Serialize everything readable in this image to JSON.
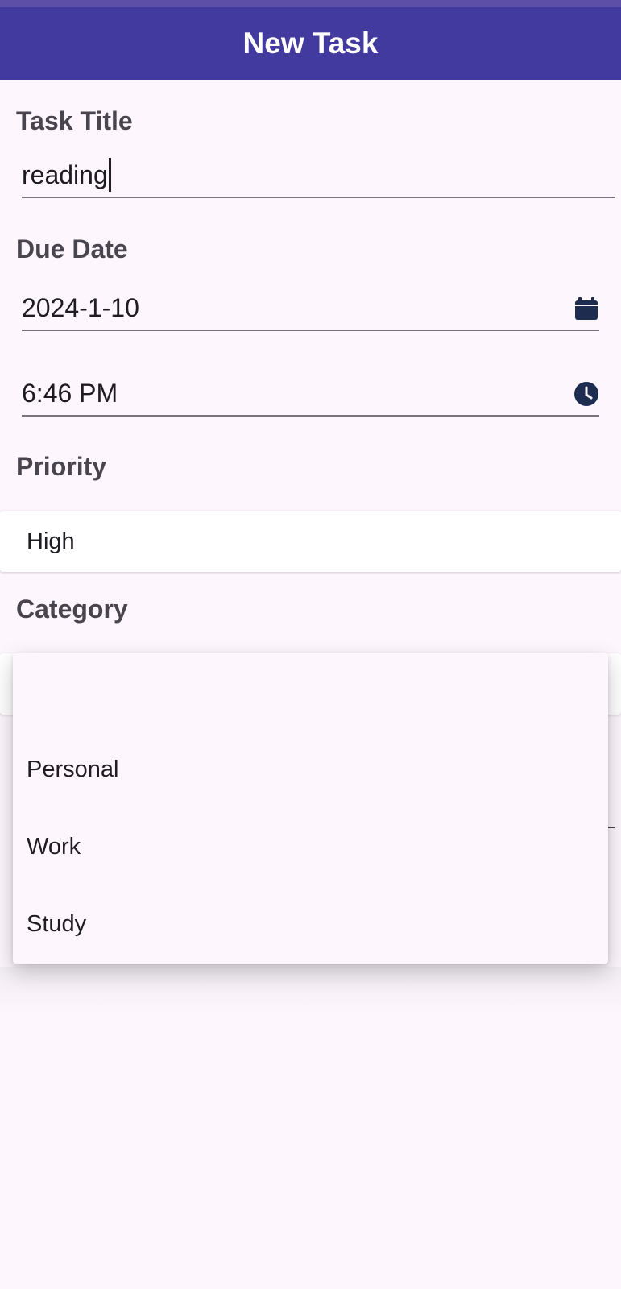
{
  "app_bar": {
    "title": "New Task"
  },
  "form": {
    "title_label": "Task Title",
    "title_value": "reading",
    "due_label": "Due Date",
    "date_value": "2024-1-10",
    "time_value": "6:46 PM",
    "priority_label": "Priority",
    "priority_value": "High",
    "category_label": "Category",
    "category_value": ""
  },
  "category_dropdown": {
    "options": [
      "",
      "Personal",
      "Work",
      "Study"
    ]
  },
  "icons": {
    "date": "calendar-icon",
    "time": "clock-icon"
  },
  "colors": {
    "app_bar": "#433a9f",
    "background": "#fdf6fd",
    "icon": "#1e2d4f"
  }
}
